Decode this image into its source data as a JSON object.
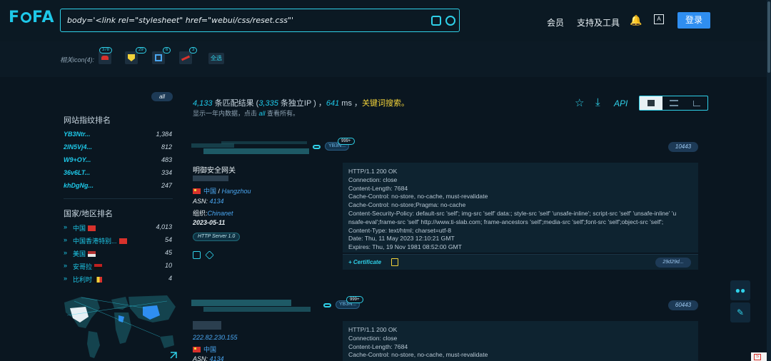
{
  "header": {
    "logo": "FOFA",
    "search_query": "body='<link rel=\"stylesheet\" href=\"webui/css/reset.css\"'",
    "nav": [
      "会员",
      "支持及工具"
    ],
    "login_label": "登录"
  },
  "related": {
    "label": "相关icon(4):",
    "icons": [
      {
        "name": "huawei-icon",
        "count": "378",
        "color": "#d8322c"
      },
      {
        "name": "shield-icon",
        "count": "29",
        "color": "#f2d23a"
      },
      {
        "name": "cube-icon",
        "count": "6",
        "color": "#4aa6f0"
      },
      {
        "name": "swoosh-icon",
        "count": "3",
        "color": "#d8322c"
      }
    ],
    "all_label": "全选"
  },
  "sidebar": {
    "all_label": "all",
    "fingerprint_title": "网站指纹排名",
    "fingerprints": [
      {
        "name": "YB3Ntr...",
        "count": "1,384"
      },
      {
        "name": "2lN5Vj4...",
        "count": "812"
      },
      {
        "name": "W9+OY...",
        "count": "483"
      },
      {
        "name": "36v6LT...",
        "count": "334"
      },
      {
        "name": "khDgNg...",
        "count": "247"
      }
    ],
    "country_title": "国家/地区排名",
    "countries": [
      {
        "name": "中国",
        "count": "4,013",
        "flag": "#d8322c"
      },
      {
        "name": "中国香港特别...",
        "count": "54",
        "flag": "#d8322c"
      },
      {
        "name": "美国",
        "count": "45",
        "flag": "#6a8ad0"
      },
      {
        "name": "安哥拉",
        "count": "10",
        "flag": "#c02020"
      },
      {
        "name": "比利时",
        "count": "4",
        "flag": "#f2d23a"
      }
    ]
  },
  "summary": {
    "total": "4,133",
    "text_a": " 条匹配结果 (",
    "unique": "3,335",
    "text_b": " 条独立IP ) ，",
    "ms": "641",
    "text_c": " ms ，",
    "keyword": "关键词搜索。",
    "note_a": "显示一年内数据，点击 ",
    "note_all": "all",
    "note_b": " 查看所有。"
  },
  "toolbar": {
    "api_label": "API"
  },
  "results": [
    {
      "domain_tag": "YB3N...",
      "badge": "999+",
      "port": "10443",
      "title": "明御安全网关",
      "country": "中国",
      "city": "Hangzhou",
      "asn_label": "ASN:",
      "asn": "4134",
      "org_label": "组织:",
      "org": "Chinanet",
      "date": "2023-05-11",
      "server_tag": "HTTP Server 1.0",
      "http": [
        "HTTP/1.1 200 OK",
        "Connection: close",
        "Content-Length: 7684",
        "Cache-Control: no-store, no-cache, must-revalidate",
        "Cache-Control: no-store;Pragma: no-cache",
        "Content-Security-Policy: default-src 'self'; img-src 'self' data:; style-src 'self' 'unsafe-inline'; script-src 'self' 'unsafe-inline' 'u",
        "nsafe-eval';frame-src 'self' http://www.ti-slab.com; frame-ancestors 'self';media-src 'self';font-src 'self';object-src 'self';",
        "Content-Type: text/html; charset=utf-8",
        "Date: Thu, 11 May 2023 12:10:21 GMT",
        "Expires: Thu, 19 Nov 1981 08:52:00 GMT"
      ],
      "cert_label": "+ Certificate",
      "cert_hash": "29d29d..."
    },
    {
      "domain_tag": "YB3N...",
      "badge": "999+",
      "port": "60443",
      "ip": "222.82.230.155",
      "country": "中国",
      "asn_label": "ASN:",
      "asn": "4134",
      "http": [
        "HTTP/1.1 200 OK",
        "Connection: close",
        "Content-Length: 7684",
        "Cache-Control: no-store, no-cache, must-revalidate"
      ]
    }
  ]
}
